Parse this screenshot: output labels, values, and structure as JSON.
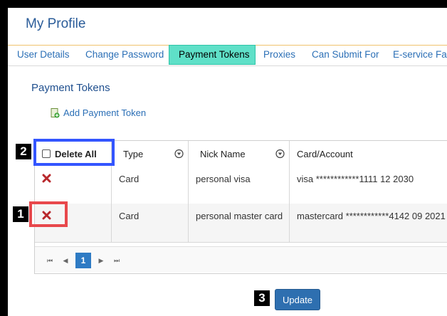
{
  "page": {
    "title": "My Profile"
  },
  "tabs": [
    {
      "label": "User Details"
    },
    {
      "label": "Change Password"
    },
    {
      "label": "Payment Tokens",
      "active": true
    },
    {
      "label": "Proxies"
    },
    {
      "label": "Can Submit For"
    },
    {
      "label": "E-service Fav"
    }
  ],
  "section": {
    "title": "Payment Tokens",
    "add_label": "Add Payment Token"
  },
  "table": {
    "headers": {
      "delete_all": "Delete All",
      "type": "Type",
      "nick_name": "Nick Name",
      "account": "Card/Account"
    },
    "rows": [
      {
        "type": "Card",
        "nick_name": "personal visa",
        "account": "visa ************1111 12 2030"
      },
      {
        "type": "Card",
        "nick_name": "personal master card",
        "account": "mastercard ************4142 09 2021"
      }
    ],
    "pager": {
      "first": "⏮",
      "prev": "◀",
      "current": "1",
      "next": "▶",
      "last": "⏭"
    }
  },
  "update_label": "Update",
  "annotations": {
    "one": "1",
    "two": "2",
    "three": "3"
  },
  "colors": {
    "accent": "#2e6fb0",
    "active_tab": "#5fe0c8",
    "highlight_red": "#e8484c",
    "highlight_blue": "#3355ff"
  }
}
